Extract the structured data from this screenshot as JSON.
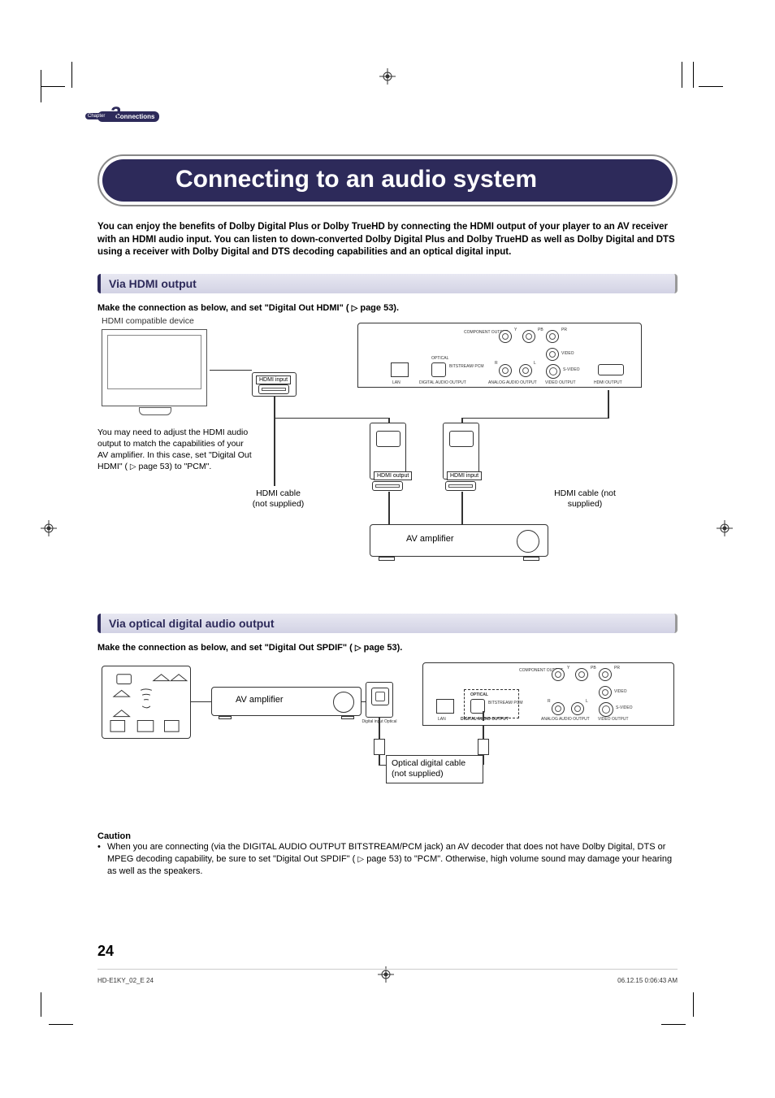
{
  "chapter": {
    "label": "Chapter",
    "number": "2",
    "title": "Connections"
  },
  "title": "Connecting to an audio system",
  "intro": "You can enjoy the benefits of Dolby Digital Plus or Dolby TrueHD by connecting the HDMI output of your player to an AV receiver with an HDMI audio input. You can listen to down-converted Dolby Digital Plus and Dolby TrueHD as well as Dolby Digital and DTS using a receiver with Dolby Digital and DTS decoding capabilities and an optical digital input.",
  "section1": {
    "heading": "Via HDMI output",
    "step_prefix": "Make the connection as below, and set \"Digital Out HDMI\" (",
    "step_suffix": " page 53).",
    "tv_label": "HDMI compatible device",
    "note": "You may need to adjust the HDMI audio output to match the capabilities of your AV amplifier. In this case, set \"Digital Out HDMI\" (",
    "note_suffix": " page 53) to \"PCM\".",
    "hdmi_input": "HDMI input",
    "hdmi_output": "HDMI output",
    "hdmi_cable_a": "HDMI cable\n(not supplied)",
    "hdmi_cable_b": "HDMI cable\n(not supplied)",
    "av_amp": "AV amplifier",
    "back_labels": {
      "component": "COMPONENT\nOUTPUT",
      "y": "Y",
      "pb": "PB",
      "pr": "PR",
      "video": "VIDEO",
      "svideo": "S-VIDEO",
      "r": "R",
      "l": "L",
      "optical": "OPTICAL",
      "bitstream": "BITSTREAM/\nPCM",
      "lan": "LAN",
      "digital_audio": "DIGITAL AUDIO OUTPUT",
      "analog_audio": "ANALOG AUDIO OUTPUT",
      "video_output": "VIDEO OUTPUT",
      "hdmi_output_label": "HDMI OUTPUT"
    }
  },
  "section2": {
    "heading": "Via optical digital audio output",
    "step_prefix": "Make the connection as below, and set \"Digital Out SPDIF\" (",
    "step_suffix": " page 53).",
    "av_amp": "AV amplifier",
    "digital_input": "Digital input\nOptical",
    "optical_cable": "Optical digital cable\n(not supplied)"
  },
  "caution": {
    "head": "Caution",
    "body": "When you are connecting (via the DIGITAL AUDIO OUTPUT BITSTREAM/PCM jack) an AV decoder that does not have Dolby Digital, DTS or MPEG decoding capability, be sure to set \"Digital Out SPDIF\" (",
    "body_suffix": " page 53) to \"PCM\". Otherwise, high volume sound may damage your hearing as well as the speakers."
  },
  "page_number": "24",
  "footer_left": "HD-E1KY_02_E   24",
  "footer_right": "06.12.15   0:06:43 AM"
}
